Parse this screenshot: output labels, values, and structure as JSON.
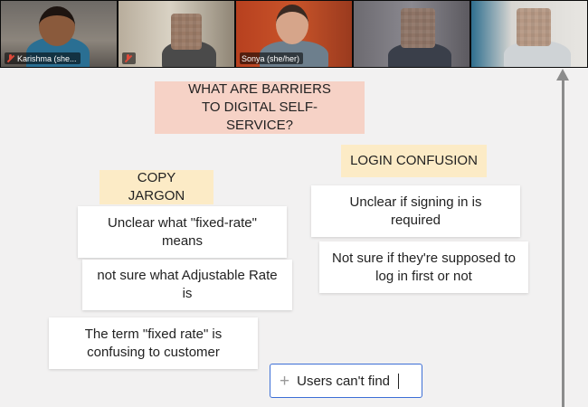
{
  "video_call": {
    "participants": [
      {
        "name": "Karishma (she...",
        "muted": true,
        "active_speaker": false,
        "blurred": false
      },
      {
        "name": "",
        "muted": true,
        "active_speaker": false,
        "blurred": true
      },
      {
        "name": "Sonya (she/her)",
        "muted": false,
        "active_speaker": true,
        "blurred": false
      },
      {
        "name": "",
        "muted": false,
        "active_speaker": false,
        "blurred": true
      },
      {
        "name": "",
        "muted": false,
        "active_speaker": false,
        "blurred": true
      }
    ]
  },
  "board": {
    "question": "WHAT ARE BARRIERS TO DIGITAL SELF-SERVICE?",
    "groups": [
      {
        "header": "COPY JARGON",
        "notes": [
          "Unclear what \"fixed-rate\" means",
          "not sure what Adjustable Rate is",
          "The term \"fixed rate\" is confusing to customer"
        ]
      },
      {
        "header": "LOGIN CONFUSION",
        "notes": [
          "Unclear if signing in is required",
          "Not sure if they're supposed to log in first or not"
        ]
      }
    ],
    "new_note_input": {
      "value": "Users can't find",
      "icon": "plus-icon"
    }
  },
  "colors": {
    "title_card": "#f6d2c6",
    "header_card": "#fcebc6",
    "input_border": "#3d6fd6",
    "active_speaker": "#a4c639",
    "muted_mic": "#e04a3a"
  }
}
